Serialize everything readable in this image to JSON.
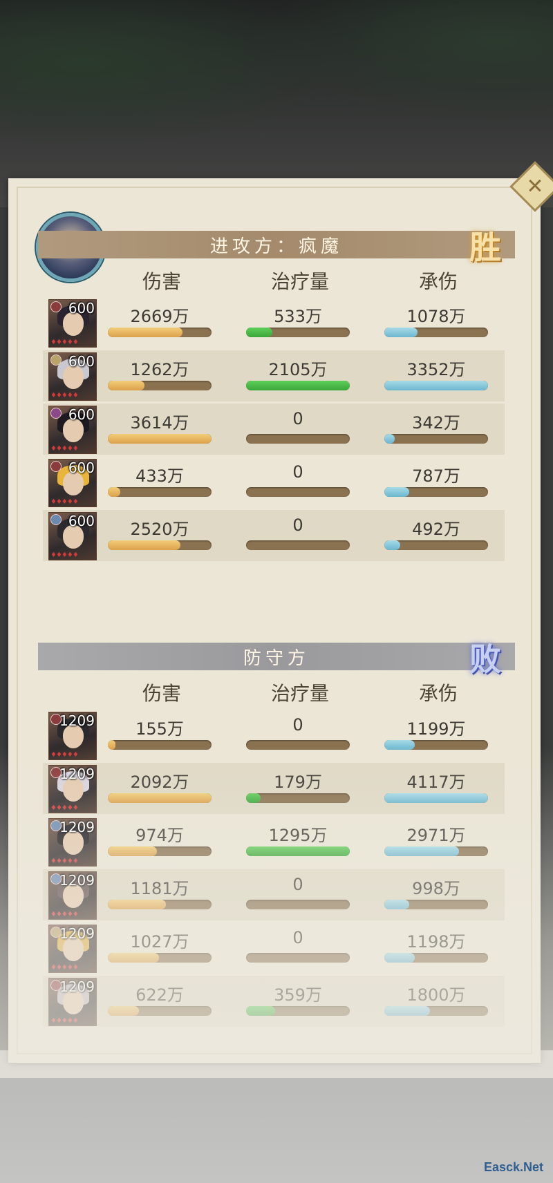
{
  "close_icon": "close-x-icon",
  "attack": {
    "title": "进攻方：疯魔",
    "result": "胜",
    "headers": [
      "伤害",
      "治疗量",
      "承伤"
    ],
    "heroes": [
      {
        "level": "600",
        "damage": "2669万",
        "heal": "533万",
        "taken": "1078万",
        "damage_frac": 0.72,
        "heal_frac": 0.25,
        "taken_frac": 0.32,
        "hair": "#2a2430",
        "elem": "#8a3c3c"
      },
      {
        "level": "600",
        "damage": "1262万",
        "heal": "2105万",
        "taken": "3352万",
        "damage_frac": 0.35,
        "heal_frac": 1.0,
        "taken_frac": 1.0,
        "hair": "#c9c7cf",
        "elem": "#b8a36a"
      },
      {
        "level": "600",
        "damage": "3614万",
        "heal": "0",
        "taken": "342万",
        "damage_frac": 1.0,
        "heal_frac": 0,
        "taken_frac": 0.1,
        "hair": "#1f1a22",
        "elem": "#8a4a8a"
      },
      {
        "level": "600",
        "damage": "433万",
        "heal": "0",
        "taken": "787万",
        "damage_frac": 0.12,
        "heal_frac": 0,
        "taken_frac": 0.24,
        "hair": "#e8b53a",
        "elem": "#8a3c3c"
      },
      {
        "level": "600",
        "damage": "2520万",
        "heal": "0",
        "taken": "492万",
        "damage_frac": 0.7,
        "heal_frac": 0,
        "taken_frac": 0.15,
        "hair": "#2c2a2f",
        "elem": "#6a8ab0"
      }
    ]
  },
  "defend": {
    "title": "防守方",
    "result": "败",
    "headers": [
      "伤害",
      "治疗量",
      "承伤"
    ],
    "heroes": [
      {
        "level": "1209",
        "damage": "155万",
        "heal": "0",
        "taken": "1199万",
        "damage_frac": 0.07,
        "heal_frac": 0,
        "taken_frac": 0.29,
        "hair": "#2a2a2e",
        "elem": "#8a3c3c"
      },
      {
        "level": "1209",
        "damage": "2092万",
        "heal": "179万",
        "taken": "4117万",
        "damage_frac": 1.0,
        "heal_frac": 0.14,
        "taken_frac": 1.0,
        "hair": "#d9d3e0",
        "elem": "#8a3c3c"
      },
      {
        "level": "1209",
        "damage": "974万",
        "heal": "1295万",
        "taken": "2971万",
        "damage_frac": 0.47,
        "heal_frac": 1.0,
        "taken_frac": 0.72,
        "hair": "#1e1a20",
        "elem": "#6a8ab0"
      },
      {
        "level": "1209",
        "damage": "1181万",
        "heal": "0",
        "taken": "998万",
        "damage_frac": 0.56,
        "heal_frac": 0,
        "taken_frac": 0.24,
        "hair": "#5a4a4a",
        "elem": "#6a8ab0"
      },
      {
        "level": "1209",
        "damage": "1027万",
        "heal": "0",
        "taken": "1198万",
        "damage_frac": 0.49,
        "heal_frac": 0,
        "taken_frac": 0.29,
        "hair": "#e0b040",
        "elem": "#b8a36a"
      },
      {
        "level": "1209",
        "damage": "622万",
        "heal": "359万",
        "taken": "1800万",
        "damage_frac": 0.3,
        "heal_frac": 0.28,
        "taken_frac": 0.44,
        "hair": "#c0b8c0",
        "elem": "#8a3c3c"
      }
    ]
  },
  "footer_watermark": "Easck.Net"
}
